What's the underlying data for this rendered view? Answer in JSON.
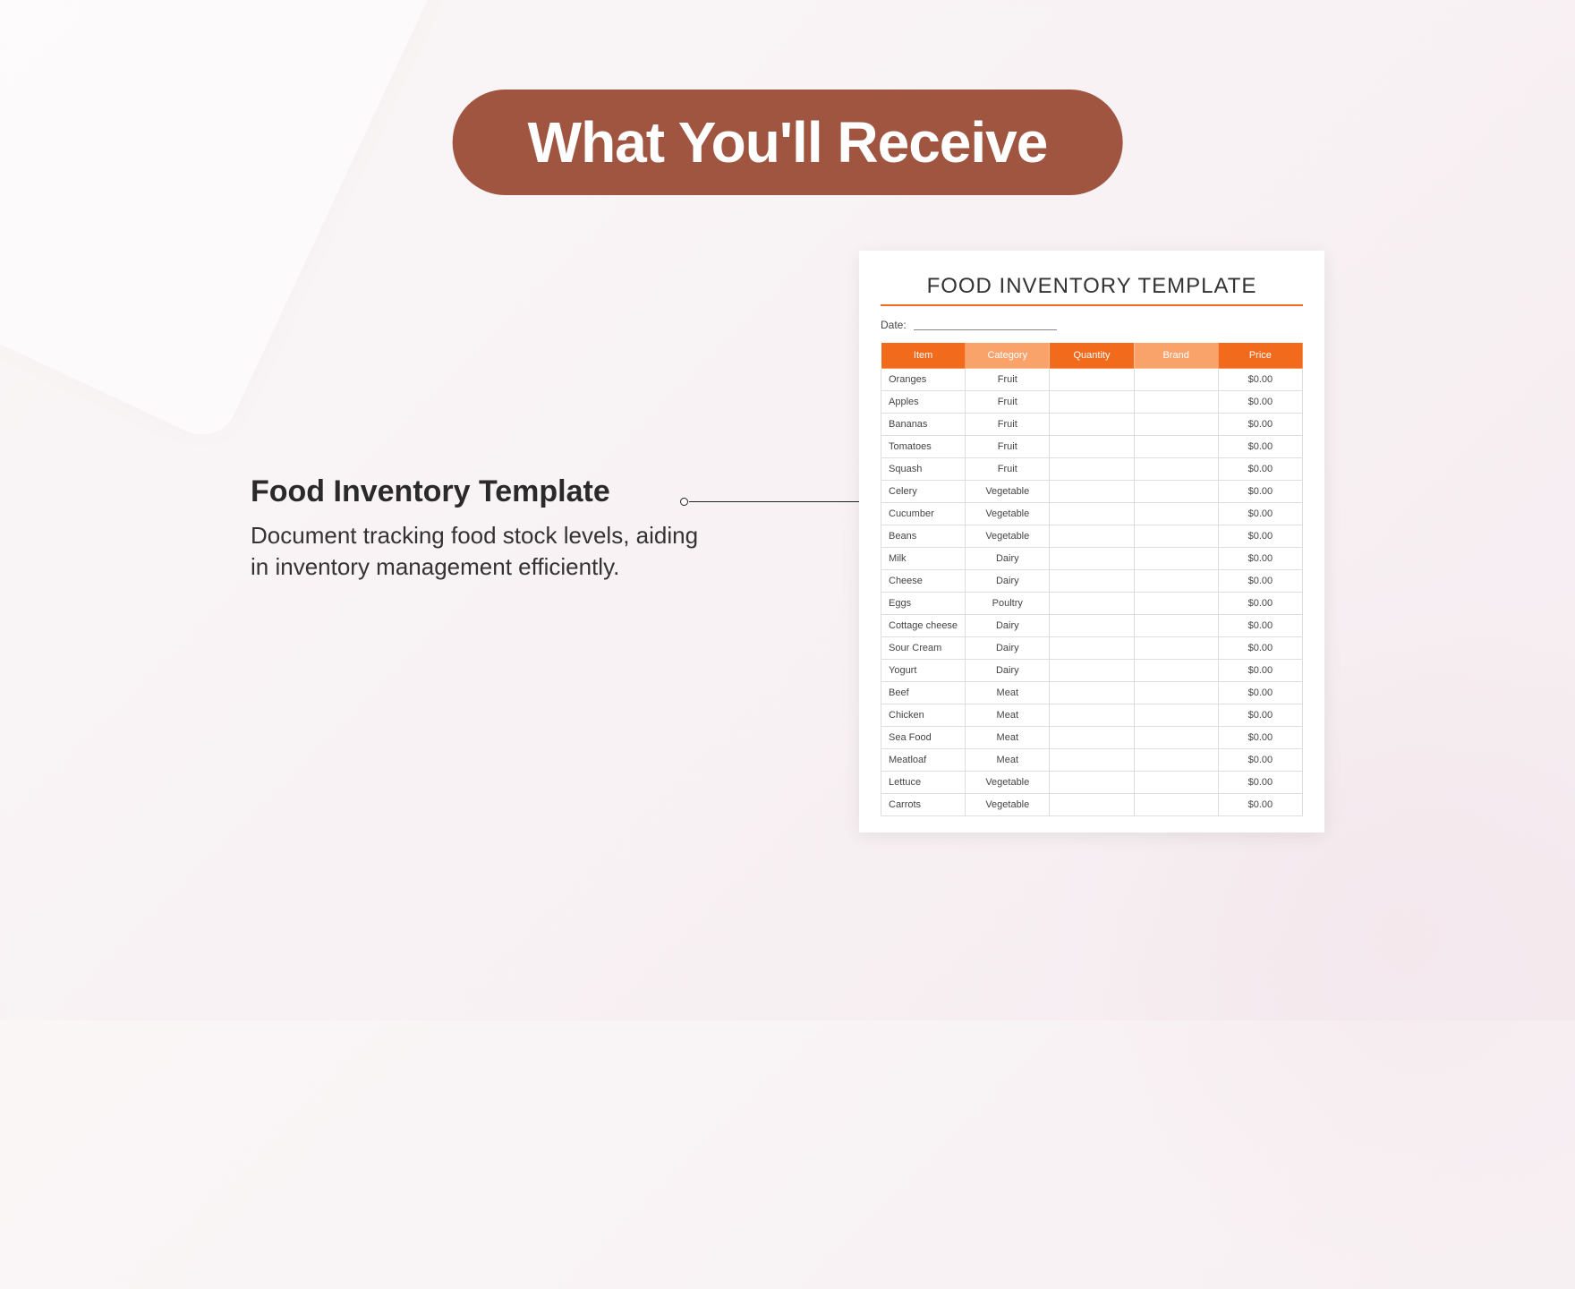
{
  "banner": "What You'll Receive",
  "description": {
    "title": "Food Inventory Template",
    "text": "Document tracking food stock levels, aiding in inventory management efficiently."
  },
  "document": {
    "title": "FOOD INVENTORY TEMPLATE",
    "date_label": "Date:",
    "headers": {
      "item": "Item",
      "category": "Category",
      "quantity": "Quantity",
      "brand": "Brand",
      "price": "Price"
    },
    "rows": [
      {
        "item": "Oranges",
        "category": "Fruit",
        "quantity": "",
        "brand": "",
        "price": "$0.00"
      },
      {
        "item": "Apples",
        "category": "Fruit",
        "quantity": "",
        "brand": "",
        "price": "$0.00"
      },
      {
        "item": "Bananas",
        "category": "Fruit",
        "quantity": "",
        "brand": "",
        "price": "$0.00"
      },
      {
        "item": "Tomatoes",
        "category": "Fruit",
        "quantity": "",
        "brand": "",
        "price": "$0.00"
      },
      {
        "item": "Squash",
        "category": "Fruit",
        "quantity": "",
        "brand": "",
        "price": "$0.00"
      },
      {
        "item": "Celery",
        "category": "Vegetable",
        "quantity": "",
        "brand": "",
        "price": "$0.00"
      },
      {
        "item": "Cucumber",
        "category": "Vegetable",
        "quantity": "",
        "brand": "",
        "price": "$0.00"
      },
      {
        "item": "Beans",
        "category": "Vegetable",
        "quantity": "",
        "brand": "",
        "price": "$0.00"
      },
      {
        "item": "Milk",
        "category": "Dairy",
        "quantity": "",
        "brand": "",
        "price": "$0.00"
      },
      {
        "item": "Cheese",
        "category": "Dairy",
        "quantity": "",
        "brand": "",
        "price": "$0.00"
      },
      {
        "item": "Eggs",
        "category": "Poultry",
        "quantity": "",
        "brand": "",
        "price": "$0.00"
      },
      {
        "item": "Cottage cheese",
        "category": "Dairy",
        "quantity": "",
        "brand": "",
        "price": "$0.00"
      },
      {
        "item": "Sour Cream",
        "category": "Dairy",
        "quantity": "",
        "brand": "",
        "price": "$0.00"
      },
      {
        "item": "Yogurt",
        "category": "Dairy",
        "quantity": "",
        "brand": "",
        "price": "$0.00"
      },
      {
        "item": "Beef",
        "category": "Meat",
        "quantity": "",
        "brand": "",
        "price": "$0.00"
      },
      {
        "item": "Chicken",
        "category": "Meat",
        "quantity": "",
        "brand": "",
        "price": "$0.00"
      },
      {
        "item": "Sea Food",
        "category": "Meat",
        "quantity": "",
        "brand": "",
        "price": "$0.00"
      },
      {
        "item": "Meatloaf",
        "category": "Meat",
        "quantity": "",
        "brand": "",
        "price": "$0.00"
      },
      {
        "item": "Lettuce",
        "category": "Vegetable",
        "quantity": "",
        "brand": "",
        "price": "$0.00"
      },
      {
        "item": "Carrots",
        "category": "Vegetable",
        "quantity": "",
        "brand": "",
        "price": "$0.00"
      }
    ]
  }
}
